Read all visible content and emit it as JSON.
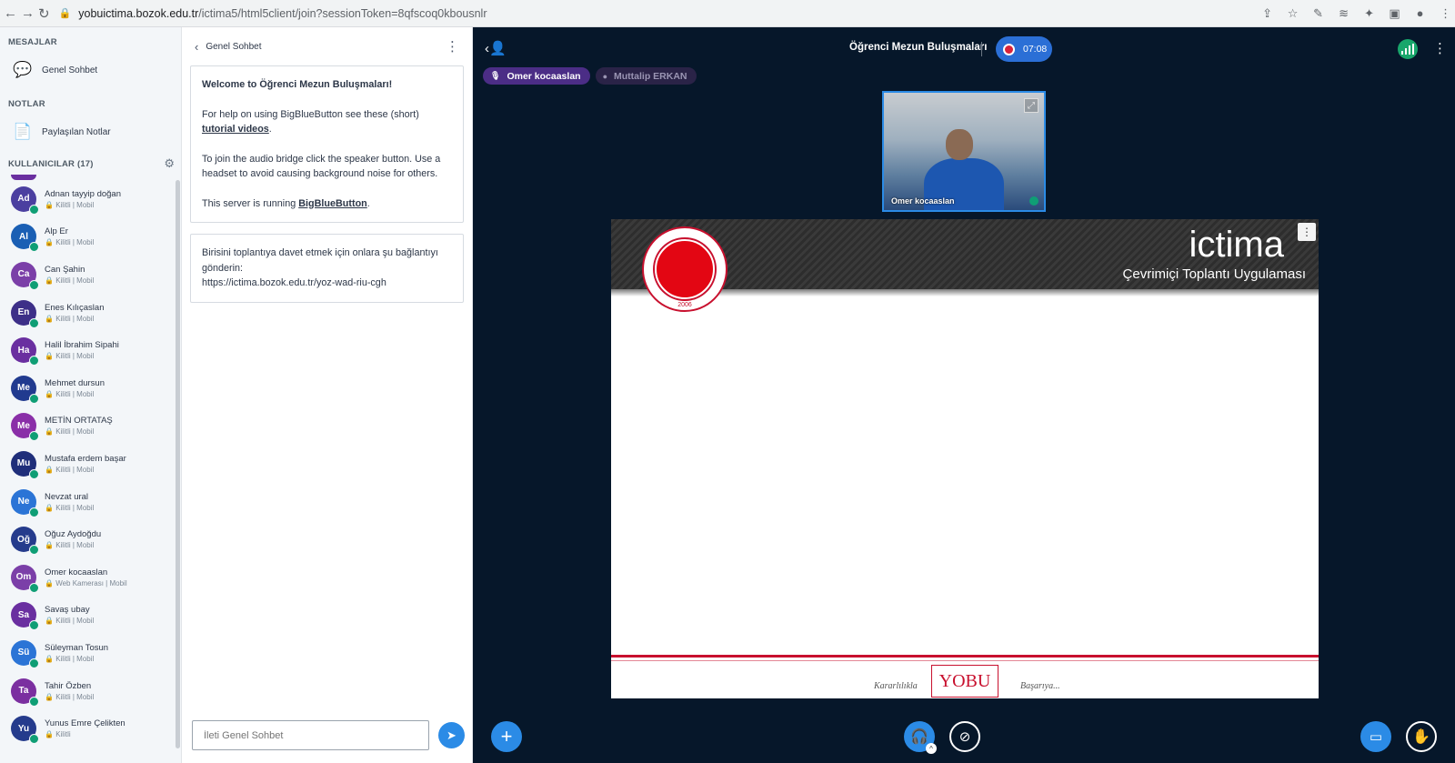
{
  "browser": {
    "url_host": "yobuictima.bozok.edu.tr",
    "url_path": "/ictima5/html5client/join?sessionToken=8qfscoq0kbousnlr"
  },
  "sidebar": {
    "messages_title": "MESAJLAR",
    "public_chat_label": "Genel Sohbet",
    "notes_title": "NOTLAR",
    "shared_notes_label": "Paylaşılan Notlar",
    "users_title": "KULLANICILAR (17)",
    "users": [
      {
        "initials": "Ad",
        "name": "Adnan tayyip doğan",
        "meta": "Kilitli | Mobil",
        "color": "#4b3fa0"
      },
      {
        "initials": "Al",
        "name": "Alp Er",
        "meta": "Kilitli | Mobil",
        "color": "#1a5fb4"
      },
      {
        "initials": "Ca",
        "name": "Can Şahin",
        "meta": "Kilitli | Mobil",
        "color": "#7b3fa8"
      },
      {
        "initials": "En",
        "name": "Enes Kılıçaslan",
        "meta": "Kilitli | Mobil",
        "color": "#3d2f88"
      },
      {
        "initials": "Ha",
        "name": "Halil İbrahim Sipahi",
        "meta": "Kilitli | Mobil",
        "color": "#6a2fa0"
      },
      {
        "initials": "Me",
        "name": "Mehmet dursun",
        "meta": "Kilitli | Mobil",
        "color": "#213a8f"
      },
      {
        "initials": "Me",
        "name": "METİN ORTATAŞ",
        "meta": "Kilitli | Mobil",
        "color": "#8a2fa8"
      },
      {
        "initials": "Mu",
        "name": "Mustafa erdem başar",
        "meta": "Kilitli | Mobil",
        "color": "#1f2e7a"
      },
      {
        "initials": "Ne",
        "name": "Nevzat ural",
        "meta": "Kilitli | Mobil",
        "color": "#2b74d6"
      },
      {
        "initials": "Oğ",
        "name": "Oğuz Aydoğdu",
        "meta": "Kilitli | Mobil",
        "color": "#253b8c"
      },
      {
        "initials": "Om",
        "name": "Omer kocaaslan",
        "meta": "Web Kamerası | Mobil",
        "color": "#7b3fa8"
      },
      {
        "initials": "Sa",
        "name": "Savaş ubay",
        "meta": "Kilitli | Mobil",
        "color": "#6a2fa0"
      },
      {
        "initials": "Sü",
        "name": "Süleyman Tosun",
        "meta": "Kilitli | Mobil",
        "color": "#2b74d6"
      },
      {
        "initials": "Ta",
        "name": "Tahir Özben",
        "meta": "Kilitli | Mobil",
        "color": "#7b2fa0"
      },
      {
        "initials": "Yu",
        "name": "Yunus Emre Çelikten",
        "meta": "Kilitli",
        "color": "#253b8c"
      }
    ]
  },
  "chat": {
    "title": "Genel Sohbet",
    "welcome_title": "Welcome to Öğrenci Mezun Buluşmaları!",
    "help_text": "For help on using BigBlueButton see these (short)",
    "help_link": "tutorial videos",
    "audio_text": "To join the audio bridge click the speaker button. Use a headset to avoid causing background noise for others.",
    "server_text": "This server is running",
    "server_link": "BigBlueButton",
    "invite_text": "Birisini toplantıya davet etmek için onlara şu bağlantıyı gönderin:",
    "invite_url": "https://ictima.bozok.edu.tr/yoz-wad-riu-cgh",
    "input_placeholder": "İleti Genel Sohbet"
  },
  "meeting": {
    "title": "Öğrenci Mezun Buluşmaları",
    "recording_time": "07:08",
    "talkers": [
      {
        "name": "Omer kocaaslan",
        "active": true
      },
      {
        "name": "Muttalip ERKAN",
        "active": false
      }
    ],
    "webcam_name": "Omer kocaaslan"
  },
  "slide": {
    "title": "ictima",
    "subtitle": "Çevrimiçi Toplantı Uygulaması",
    "seal_year": "2006",
    "logo_text": "YOBU",
    "footer_left": "Kararlılıkla",
    "footer_right": "Başarıya..."
  },
  "icons": {
    "back": "arrow-left-icon",
    "forward": "arrow-right-icon",
    "reload": "reload-icon",
    "lock": "lock-icon",
    "chat": "chat-bubble-icon",
    "notes": "notes-icon",
    "gear": "gear-icon",
    "send": "send-icon",
    "plus": "plus-icon",
    "headset": "headset-icon",
    "camera_off": "camera-off-icon",
    "presentation": "presentation-icon",
    "hand": "raise-hand-icon"
  }
}
